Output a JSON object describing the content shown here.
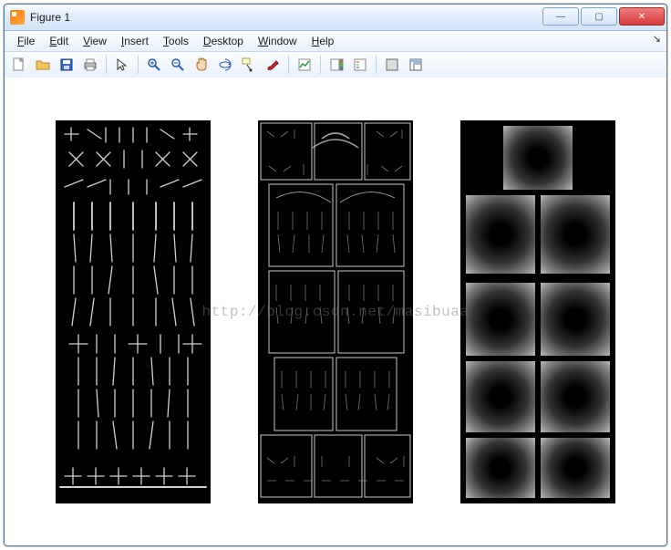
{
  "window": {
    "title": "Figure 1"
  },
  "window_controls": {
    "minimize_glyph": "—",
    "maximize_glyph": "▢",
    "close_glyph": "✕"
  },
  "menubar": {
    "items": [
      {
        "label": "File",
        "accel": "F"
      },
      {
        "label": "Edit",
        "accel": "E"
      },
      {
        "label": "View",
        "accel": "V"
      },
      {
        "label": "Insert",
        "accel": "I"
      },
      {
        "label": "Tools",
        "accel": "T"
      },
      {
        "label": "Desktop",
        "accel": "D"
      },
      {
        "label": "Window",
        "accel": "W"
      },
      {
        "label": "Help",
        "accel": "H"
      }
    ],
    "overflow_glyph": "↘"
  },
  "toolbar": {
    "buttons": [
      "new-figure-icon",
      "open-icon",
      "save-icon",
      "print-icon",
      "SEPARATOR",
      "pointer-icon",
      "SEPARATOR",
      "zoom-in-icon",
      "zoom-out-icon",
      "pan-icon",
      "rotate3d-icon",
      "data-cursor-icon",
      "brush-icon",
      "SEPARATOR",
      "link-plot-icon",
      "SEPARATOR",
      "colorbar-icon",
      "legend-icon",
      "SEPARATOR",
      "hide-tools-icon",
      "dock-icon"
    ]
  },
  "figure": {
    "subplots": [
      {
        "kind": "hog-full"
      },
      {
        "kind": "hog-parts"
      },
      {
        "kind": "spatial-weights"
      }
    ]
  },
  "watermark": "http://blog.csdn.net/masibuaa"
}
